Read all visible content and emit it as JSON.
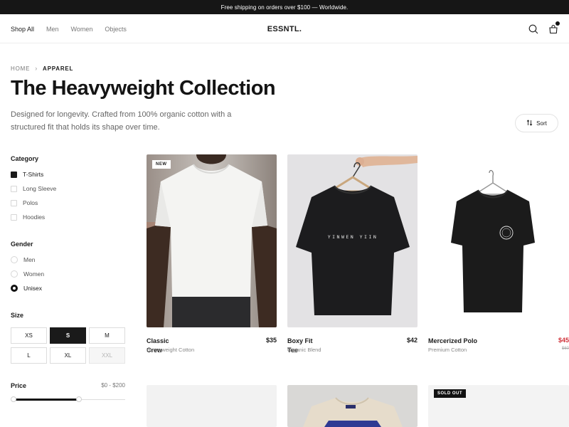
{
  "announcement": "Free shipping on orders over $100 — Worldwide.",
  "nav": {
    "links": [
      "Shop All",
      "Men",
      "Women",
      "Objects"
    ],
    "logo": "ESSNTL."
  },
  "breadcrumb": {
    "home": "HOME",
    "separator": "›",
    "current": "APPAREL"
  },
  "page": {
    "title": "The Heavyweight Collection",
    "description": "Designed for longevity. Crafted from 100% organic cotton with a structured fit that holds its shape over time."
  },
  "sort": {
    "label": "Sort",
    "icon": "sort-arrows-icon"
  },
  "filters": {
    "category": {
      "heading": "Category",
      "options": [
        "T-Shirts",
        "Long Sleeve",
        "Polos",
        "Hoodies"
      ],
      "selected": "T-Shirts"
    },
    "gender": {
      "heading": "Gender",
      "options": [
        "Men",
        "Women",
        "Unisex"
      ],
      "selected": "Unisex"
    },
    "size": {
      "heading": "Size",
      "options": [
        "XS",
        "S",
        "M",
        "L",
        "XL",
        "XXL"
      ],
      "selected": "S",
      "unavailable": [
        "XXL"
      ]
    },
    "price": {
      "heading": "Price",
      "range": "$0 - $200",
      "min_value": 0,
      "max_value": 200,
      "range_min": 0,
      "range_max": 200,
      "selected_upper_fraction": 0.6
    }
  },
  "products": [
    {
      "name": "Classic Crew",
      "price": "$35",
      "subtitle": "Heavyweight Cotton",
      "badge": "NEW"
    },
    {
      "name": "Boxy Fit Tee",
      "price": "$42",
      "subtitle": "Organic Blend"
    },
    {
      "name": "Mercerized Polo",
      "price": "$45",
      "old_price": "$60",
      "subtitle": "Premium Cotton"
    },
    {
      "name": "",
      "price": "",
      "subtitle": ""
    },
    {
      "name": "",
      "price": "",
      "subtitle": ""
    },
    {
      "name": "",
      "price": "",
      "subtitle": "",
      "badge": "SOLD OUT"
    }
  ],
  "print_text": "YINWEN YIIN",
  "colors": {
    "accent": "#161616",
    "sale": "#d0323a"
  }
}
